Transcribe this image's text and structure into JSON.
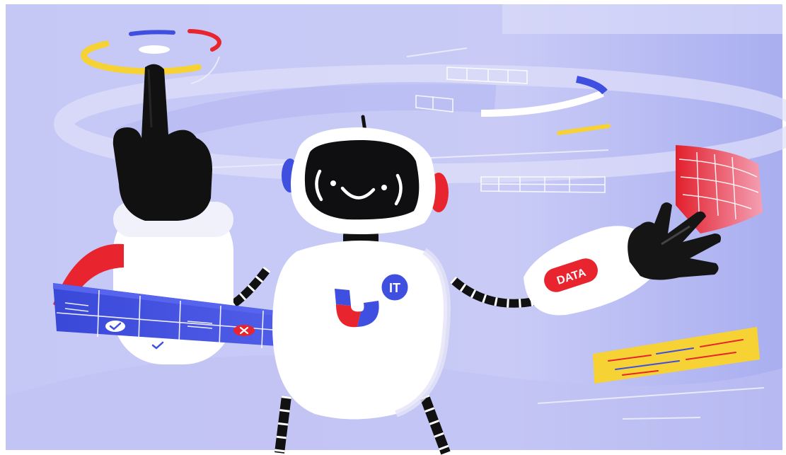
{
  "illustration": {
    "badge_it": "IT",
    "arm_label": "DATA"
  },
  "colors": {
    "background": "#c9cbf6",
    "background_light": "#dedff9",
    "accent_blue": "#3f4fe0",
    "accent_red": "#e8242f",
    "accent_yellow": "#f6d234",
    "robot_white": "#ffffff",
    "robot_black": "#111111"
  },
  "icons": [
    "magnet-icon",
    "check-icon",
    "cross-icon",
    "robot-face-icon"
  ]
}
